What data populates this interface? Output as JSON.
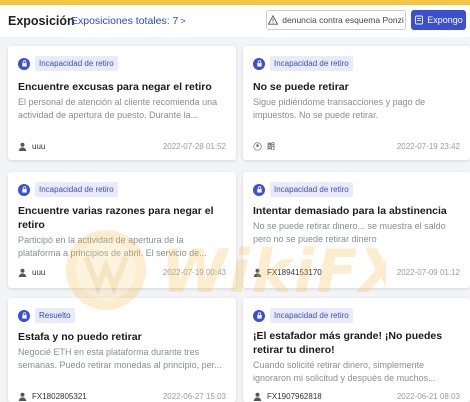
{
  "header": {
    "title": "Exposición",
    "total_label": "Exposiciones totales: 7",
    "chevron": ">",
    "report_button": "denuncia contra esquema Ponzi",
    "expose_button": "Expongo"
  },
  "colors": {
    "accent": "#3b4fd1",
    "top_strip": "#f5c542",
    "badge_bg": "#e9ebf9"
  },
  "watermark": "WikiFX",
  "cards": [
    {
      "badge": "Incapacidad de retiro",
      "title": "Encuentre excusas para negar el retiro",
      "desc": "El personal de atención al cliente recomienda una actividad de apertura de puesto. Durante la...",
      "user": "uuu",
      "date": "2022-07-28 01:52"
    },
    {
      "badge": "Incapacidad de retiro",
      "title": "No se puede retirar",
      "desc": "Sigue pidiéndome transacciones y pago de impuestos. No se puede retirar.",
      "user": "朗",
      "date": "2022-07-19 23:42"
    },
    {
      "badge": "Incapacidad de retiro",
      "title": "Encuentre varias razones para negar el retiro",
      "desc": "Participó en la actividad de apertura de la plataforma a principios de abril. El servicio de...",
      "user": "uuu",
      "date": "2022-07-19 00:43"
    },
    {
      "badge": "Incapacidad de retiro",
      "title": "Intentar demasiado para la abstinencia",
      "desc": "No se puede retirar dinero... se muestra el saldo pero no se puede retirar dinero",
      "user": "FX1894153170",
      "date": "2022-07-09 01:12"
    },
    {
      "badge": "Resuelto",
      "title": "Estafa y no puedo retirar",
      "desc": "Negocié ETH en esta plataforma durante tres semanas. Puedo retirar monedas al principio, per...",
      "user": "FX1802805321",
      "date": "2022-06-27 15:03"
    },
    {
      "badge": "Incapacidad de retiro",
      "title": "¡El estafador más grande! ¡No puedes retirar tu dinero!",
      "desc": "Cuando solicité retirar dinero, simplemente ignoraron mi solicitud y después de muchos...",
      "user": "FX1907962818",
      "date": "2022-06-21 08:03"
    }
  ]
}
